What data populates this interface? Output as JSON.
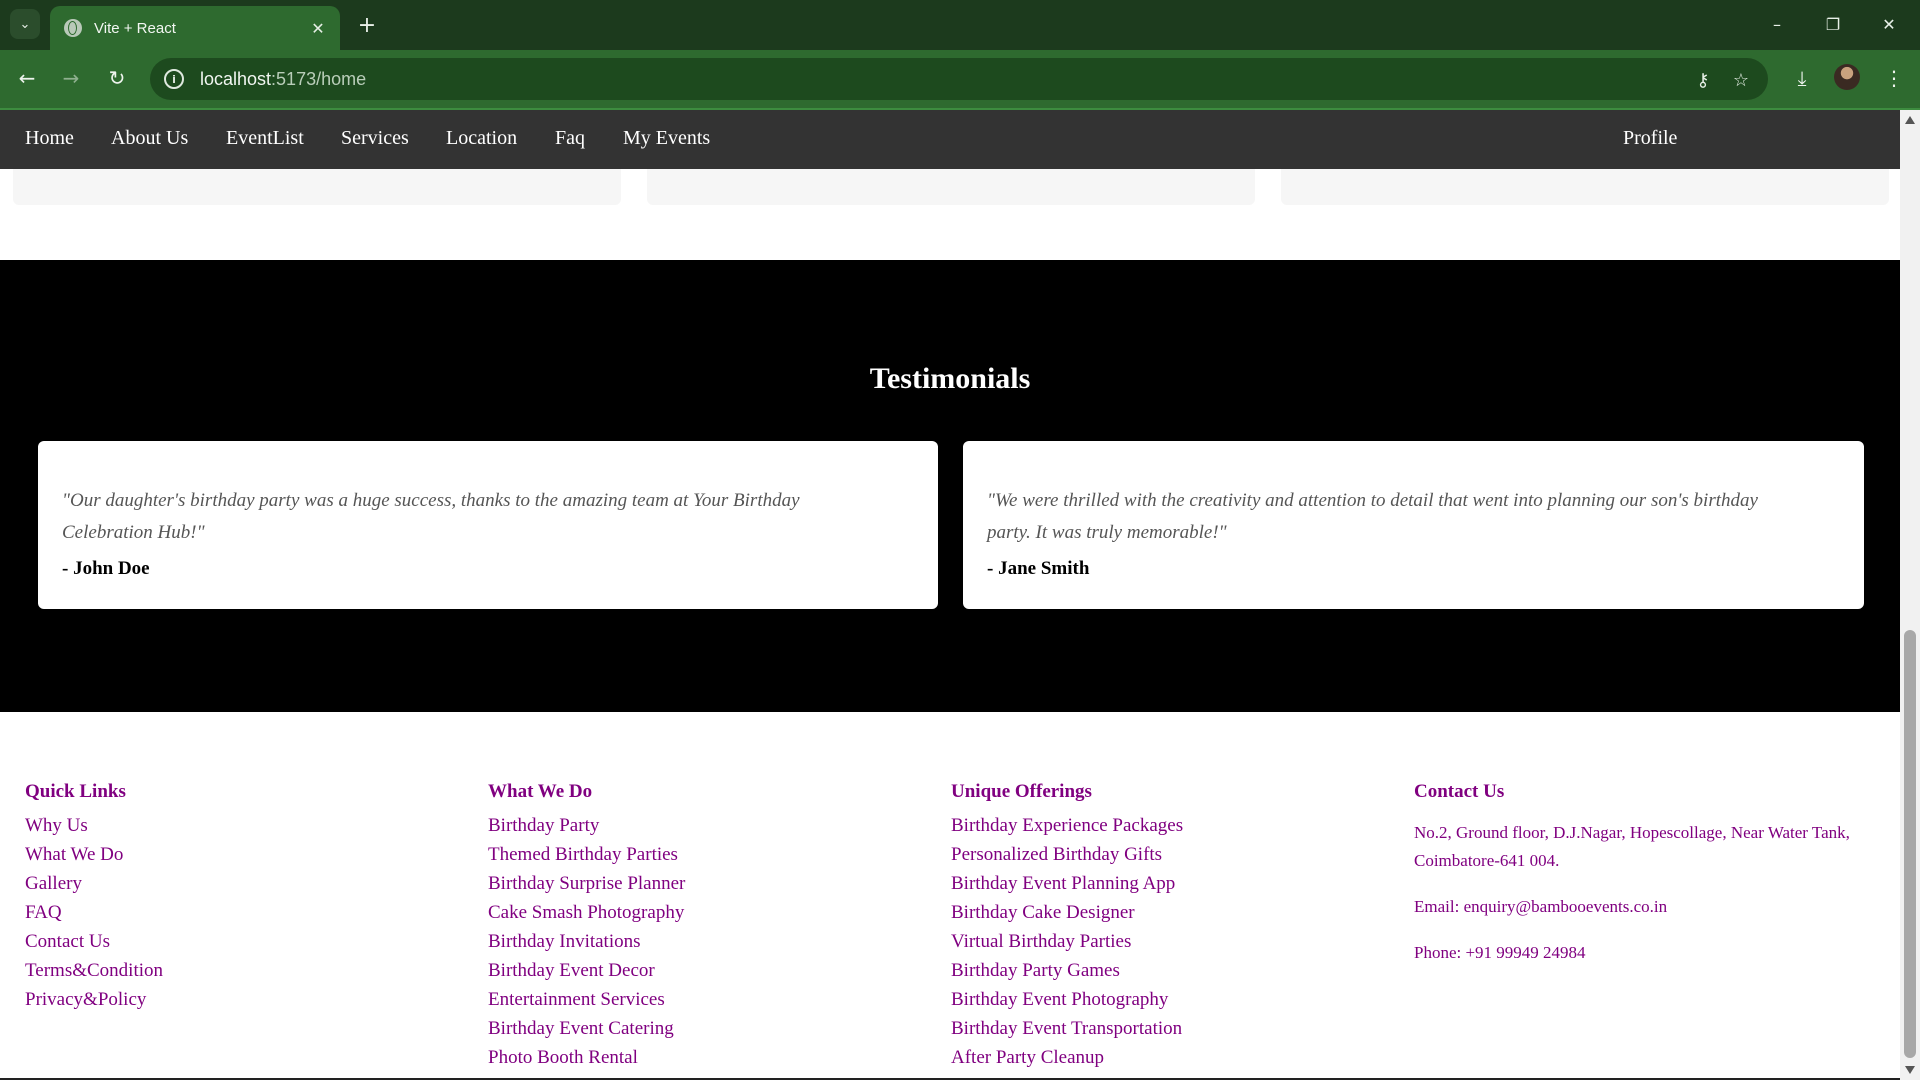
{
  "browser": {
    "tab_title": "Vite + React",
    "url_host": "localhost",
    "url_path": ":5173/home",
    "icons": {
      "tab_search": "chevron-down-icon",
      "tab_favicon": "globe-icon",
      "tab_close": "close-icon",
      "new_tab": "plus-icon",
      "minimize": "minimize-icon",
      "restore": "restore-icon",
      "window_close": "close-icon",
      "back": "arrow-left-icon",
      "forward": "arrow-right-icon",
      "reload": "reload-icon",
      "site_info": "info-icon",
      "password": "key-icon",
      "bookmark": "star-icon",
      "downloads": "download-icon",
      "menu": "kebab-menu-icon"
    }
  },
  "nav": {
    "items": [
      "Home",
      "About Us",
      "EventList",
      "Services",
      "Location",
      "Faq",
      "My Events"
    ],
    "profile": "Profile"
  },
  "testimonials": {
    "title": "Testimonials",
    "items": [
      {
        "quote_line1": "\"Our daughter's birthday party was a huge success, thanks to the amazing team at Your Birthday",
        "quote_line2": "Celebration Hub!\"",
        "author": "- John Doe"
      },
      {
        "quote_line1": "\"We were thrilled with the creativity and attention to detail that went into planning our son's birthday",
        "quote_line2": "party. It was truly memorable!\"",
        "author": "- Jane Smith"
      }
    ]
  },
  "footer": {
    "quick_links": {
      "title": "Quick Links",
      "links": [
        "Why Us",
        "What We Do",
        "Gallery",
        "FAQ",
        "Contact Us",
        "Terms&Condition",
        "Privacy&Policy"
      ]
    },
    "what_we_do": {
      "title": "What We Do",
      "links": [
        "Birthday Party",
        "Themed Birthday Parties",
        "Birthday Surprise Planner",
        "Cake Smash Photography",
        "Birthday Invitations",
        "Birthday Event Decor",
        "Entertainment Services",
        "Birthday Event Catering",
        "Photo Booth Rental"
      ]
    },
    "unique_offerings": {
      "title": "Unique Offerings",
      "links": [
        "Birthday Experience Packages",
        "Personalized Birthday Gifts",
        "Birthday Event Planning App",
        "Birthday Cake Designer",
        "Virtual Birthday Parties",
        "Birthday Party Games",
        "Birthday Event Photography",
        "Birthday Event Transportation",
        "After Party Cleanup"
      ]
    },
    "contact": {
      "title": "Contact Us",
      "address_line1": "No.2, Ground floor, D.J.Nagar, Hopescollage, Near Water Tank,",
      "address_line2": "Coimbatore-641 004.",
      "email": "Email: enquiry@bambooevents.co.in",
      "phone": "Phone: +91 99949 24984"
    }
  },
  "colors": {
    "browser_frame": "#1c3a1d",
    "browser_toolbar": "#2e6a2f",
    "site_nav": "#333333",
    "testimonials_bg": "#000000",
    "footer_link": "#800080"
  }
}
